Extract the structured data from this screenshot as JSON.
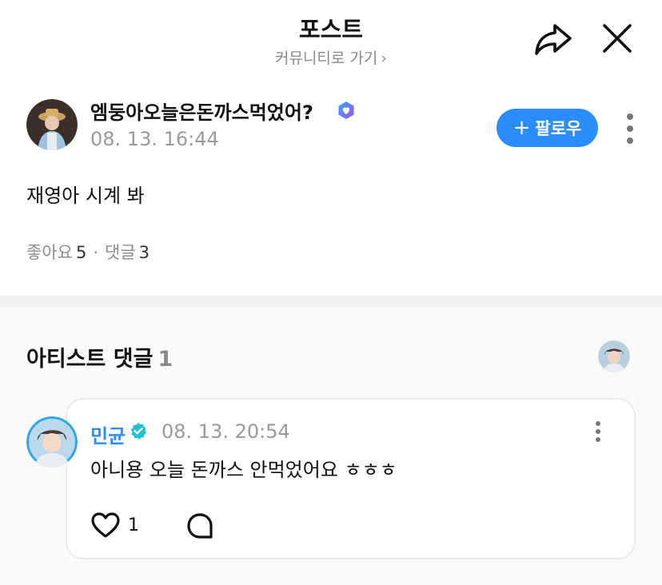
{
  "header": {
    "title": "포스트",
    "community_link": "커뮤니티로 가기",
    "community_chevron": "›",
    "share_icon": "share-icon",
    "close_icon": "close-icon"
  },
  "post": {
    "author_name": "엠둥아오늘은돈까스먹었어?",
    "author_badge_icon": "member-badge-icon",
    "timestamp": "08. 13. 16:44",
    "follow_label": "팔로우",
    "follow_plus": "+",
    "body": "재영아 시계 봐",
    "likes_label": "좋아요",
    "likes_count": "5",
    "separator": "·",
    "comments_label": "댓글",
    "comments_count": "3"
  },
  "artist_comments": {
    "title": "아티스트 댓글",
    "count": "1",
    "comments": [
      {
        "author": "민균",
        "verified_icon": "verified-check-icon",
        "timestamp": "08. 13. 20:54",
        "text": "아니용 오늘 돈까스 안먹었어요 ㅎㅎㅎ",
        "likes": "1"
      }
    ]
  },
  "colors": {
    "accent": "#2a8dfb",
    "badge_purple": "#7b5cf0",
    "verified_teal": "#20c0d6",
    "muted_text": "#9a9a9a"
  }
}
